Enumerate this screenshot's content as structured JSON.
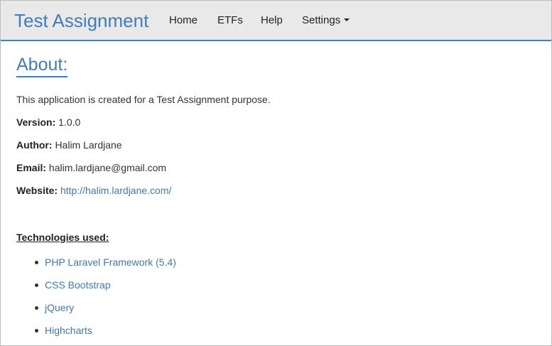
{
  "navbar": {
    "brand": "Test Assignment",
    "items": [
      {
        "label": "Home"
      },
      {
        "label": "ETFs"
      },
      {
        "label": "Help"
      },
      {
        "label": "Settings"
      }
    ]
  },
  "about": {
    "title": "About:",
    "description": "This application is created for a Test Assignment purpose.",
    "version_label": "Version:",
    "version": "1.0.0",
    "author_label": "Author:",
    "author": "Halim Lardjane",
    "email_label": "Email:",
    "email": "halim.lardjane@gmail.com",
    "website_label": "Website:",
    "website": "http://halim.lardjane.com/"
  },
  "technologies": {
    "heading": "Technologies used:",
    "items": [
      "PHP Laravel Framework (5.4)",
      "CSS Bootstrap",
      "jQuery",
      "Highcharts"
    ]
  },
  "colors": {
    "accent": "#3f7dbe",
    "navbar_bg": "#e9e9e9",
    "link": "#3f79ad"
  },
  "icons": {
    "settings_dropdown": "caret-down-icon"
  }
}
